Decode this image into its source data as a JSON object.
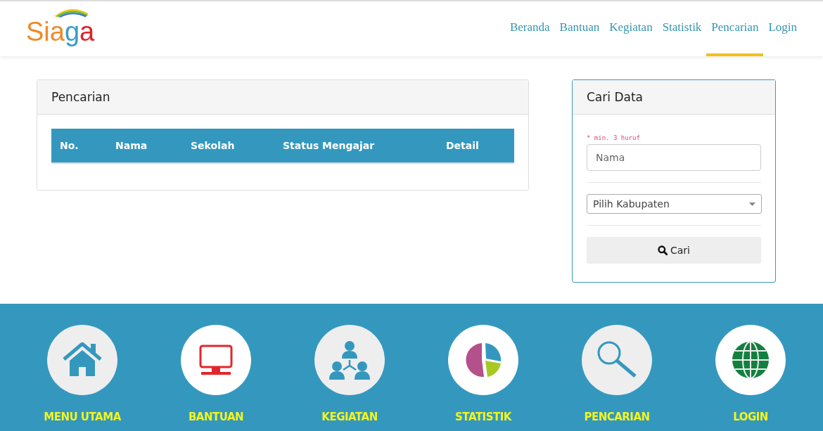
{
  "logo": {
    "text": "Siaga"
  },
  "nav": [
    {
      "label": "Beranda",
      "selected": false
    },
    {
      "label": "Bantuan",
      "selected": false
    },
    {
      "label": "Kegiatan",
      "selected": false
    },
    {
      "label": "Statistik",
      "selected": false
    },
    {
      "label": "Pencarian",
      "selected": true
    },
    {
      "label": "Login",
      "selected": false
    }
  ],
  "results_panel": {
    "title": "Pencarian",
    "table": {
      "columns": [
        "No.",
        "Nama",
        "Sekolah",
        "Status Mengajar",
        "Detail"
      ]
    }
  },
  "search_panel": {
    "title": "Cari Data",
    "hint": "* min. 3 huruf",
    "name_field": {
      "placeholder": "Nama"
    },
    "district_select": {
      "value": "Pilih Kabupaten"
    },
    "search_button": "Cari"
  },
  "footer_menu": [
    {
      "label": "MENU UTAMA",
      "kind": "home"
    },
    {
      "label": "BANTUAN",
      "kind": "monitor"
    },
    {
      "label": "KEGIATAN",
      "kind": "people"
    },
    {
      "label": "STATISTIK",
      "kind": "pie"
    },
    {
      "label": "PENCARIAN",
      "kind": "search"
    },
    {
      "label": "LOGIN",
      "kind": "globe"
    }
  ]
}
